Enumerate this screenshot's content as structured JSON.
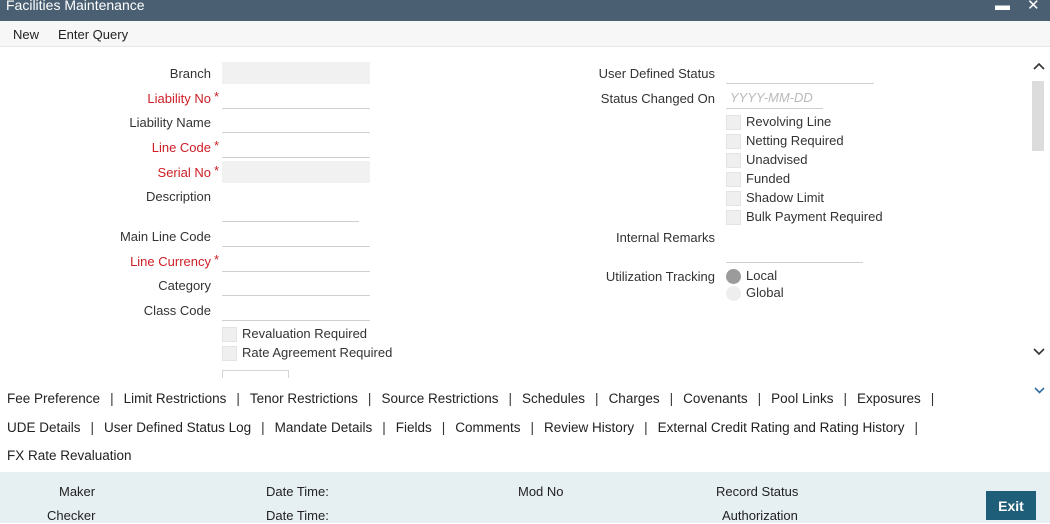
{
  "window": {
    "title": "Facilities Maintenance",
    "minimize_glyph": "▬",
    "close_glyph": "✕"
  },
  "menu": {
    "new": "New",
    "enter_query": "Enter Query"
  },
  "left": {
    "branch": "Branch",
    "liability_no": "Liability No",
    "liability_name": "Liability Name",
    "line_code": "Line Code",
    "serial_no": "Serial No",
    "description": "Description",
    "main_line_code": "Main Line Code",
    "line_currency": "Line Currency",
    "category": "Category",
    "class_code": "Class Code",
    "revaluation_required": "Revaluation Required",
    "rate_agreement_required": "Rate Agreement Required"
  },
  "required_marker": "*",
  "right": {
    "user_defined_status": "User Defined Status",
    "status_changed_on": "Status Changed On",
    "date_placeholder": "YYYY-MM-DD",
    "revolving_line": "Revolving Line",
    "netting_required": "Netting Required",
    "unadvised": "Unadvised",
    "funded": "Funded",
    "shadow_limit": "Shadow Limit",
    "bulk_payment_required": "Bulk Payment Required",
    "internal_remarks": "Internal Remarks",
    "utilization_tracking": "Utilization Tracking",
    "local": "Local",
    "global": "Global"
  },
  "tabs": {
    "fee_preference": "Fee Preference",
    "limit_restrictions": "Limit Restrictions",
    "tenor_restrictions": "Tenor Restrictions",
    "source_restrictions": "Source Restrictions",
    "schedules": "Schedules",
    "charges": "Charges",
    "covenants": "Covenants",
    "pool_links": "Pool Links",
    "exposures": "Exposures",
    "ude_details": "UDE Details",
    "user_defined_status_log": "User Defined Status Log",
    "mandate_details": "Mandate Details",
    "fields": "Fields",
    "comments": "Comments",
    "review_history": "Review History",
    "external_credit_rating": "External Credit Rating and Rating History",
    "fx_rate_revaluation": "FX Rate Revaluation",
    "separator": "|"
  },
  "footer": {
    "maker": "Maker",
    "checker": "Checker",
    "date_time": "Date Time:",
    "date_time_2": "Date Time:",
    "mod_no": "Mod No",
    "record_status": "Record Status",
    "authorization": "Authorization",
    "exit": "Exit"
  },
  "icons": {
    "scroll_up": "chevron-up-icon",
    "scroll_down": "chevron-down-icon",
    "tabs_expand": "chevron-down-icon"
  },
  "colors": {
    "titlebar": "#4a6072",
    "required": "#cc1f26",
    "exit_button": "#1f5e79",
    "footer_bg": "#e6eff2"
  }
}
